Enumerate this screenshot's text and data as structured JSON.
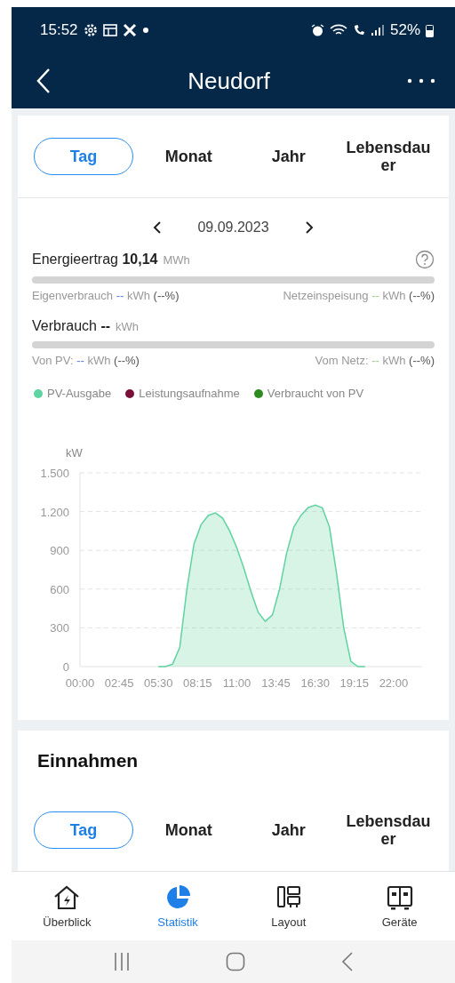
{
  "status_bar": {
    "time": "15:52",
    "battery": "52%"
  },
  "header": {
    "title": "Neudorf"
  },
  "period_tabs": [
    {
      "label": "Tag",
      "selected": true
    },
    {
      "label": "Monat",
      "selected": false
    },
    {
      "label": "Jahr",
      "selected": false
    },
    {
      "label": "Lebensdauer",
      "selected": false
    }
  ],
  "date": "09.09.2023",
  "yield": {
    "label": "Energieertrag",
    "value": "10,14",
    "unit": "MWh",
    "left_label": "Eigenverbrauch",
    "left_value": "--",
    "left_unit": "kWh",
    "left_pct": "(--%)",
    "right_label": "Netzeinspeisung",
    "right_value": "--",
    "right_unit": "kWh",
    "right_pct": "(--%)"
  },
  "consumption": {
    "label": "Verbrauch",
    "value": "--",
    "unit": "kWh",
    "left_label": "Von PV:",
    "left_value": "--",
    "left_unit": "kWh",
    "left_pct": "(--%)",
    "right_label": "Vom Netz:",
    "right_value": "--",
    "right_unit": "kWh",
    "right_pct": "(--%)"
  },
  "chart_data": {
    "type": "area",
    "ylabel": "kW",
    "xlim": [
      0,
      24
    ],
    "ylim": [
      0,
      1500
    ],
    "grid": true,
    "x": [
      5.5,
      6,
      6.5,
      7,
      7.5,
      8,
      8.5,
      9,
      9.5,
      10,
      10.5,
      11,
      11.5,
      12,
      12.5,
      13,
      13.5,
      14,
      14.5,
      15,
      15.5,
      16,
      16.5,
      17,
      17.5,
      18,
      18.5,
      19,
      19.5,
      20
    ],
    "series": [
      {
        "name": "PV-Ausgabe",
        "color": "#5fd3a0",
        "values": [
          0,
          0,
          20,
          150,
          600,
          950,
          1100,
          1170,
          1190,
          1150,
          1050,
          920,
          760,
          580,
          420,
          350,
          400,
          600,
          880,
          1080,
          1170,
          1230,
          1250,
          1230,
          1080,
          720,
          300,
          40,
          0,
          0
        ]
      },
      {
        "name": "Leistungsaufnahme",
        "color": "#7a0f3a",
        "values": [
          null,
          null,
          null,
          null,
          null,
          null,
          null,
          null,
          null,
          null,
          null,
          null,
          null,
          null,
          null,
          null,
          null,
          null,
          null,
          null,
          null,
          null,
          null,
          null,
          null,
          null,
          null,
          null,
          null,
          null
        ]
      },
      {
        "name": "Verbraucht von PV",
        "color": "#2e8b1e",
        "values": [
          null,
          null,
          null,
          null,
          null,
          null,
          null,
          null,
          null,
          null,
          null,
          null,
          null,
          null,
          null,
          null,
          null,
          null,
          null,
          null,
          null,
          null,
          null,
          null,
          null,
          null,
          null,
          null,
          null,
          null
        ]
      }
    ],
    "yticks": [
      {
        "value": 0,
        "label": "0"
      },
      {
        "value": 300,
        "label": "300"
      },
      {
        "value": 600,
        "label": "600"
      },
      {
        "value": 900,
        "label": "900"
      },
      {
        "value": 1200,
        "label": "1.200"
      },
      {
        "value": 1500,
        "label": "1.500"
      }
    ],
    "xticks": [
      {
        "value": 0,
        "label": "00:00"
      },
      {
        "value": 2.75,
        "label": "02:45"
      },
      {
        "value": 5.5,
        "label": "05:30"
      },
      {
        "value": 8.25,
        "label": "08:15"
      },
      {
        "value": 11,
        "label": "11:00"
      },
      {
        "value": 13.75,
        "label": "13:45"
      },
      {
        "value": 16.5,
        "label": "16:30"
      },
      {
        "value": 19.25,
        "label": "19:15"
      },
      {
        "value": 22,
        "label": "22:00"
      }
    ]
  },
  "income": {
    "title": "Einnahmen",
    "tabs": [
      {
        "label": "Tag",
        "selected": true
      },
      {
        "label": "Monat",
        "selected": false
      },
      {
        "label": "Jahr",
        "selected": false
      },
      {
        "label": "Lebensdauer",
        "selected": false
      }
    ]
  },
  "bottom_nav": [
    {
      "label": "Überblick",
      "kind": "home",
      "selected": false
    },
    {
      "label": "Statistik",
      "kind": "pie",
      "selected": true
    },
    {
      "label": "Layout",
      "kind": "layout",
      "selected": false
    },
    {
      "label": "Geräte",
      "kind": "device",
      "selected": false
    }
  ]
}
